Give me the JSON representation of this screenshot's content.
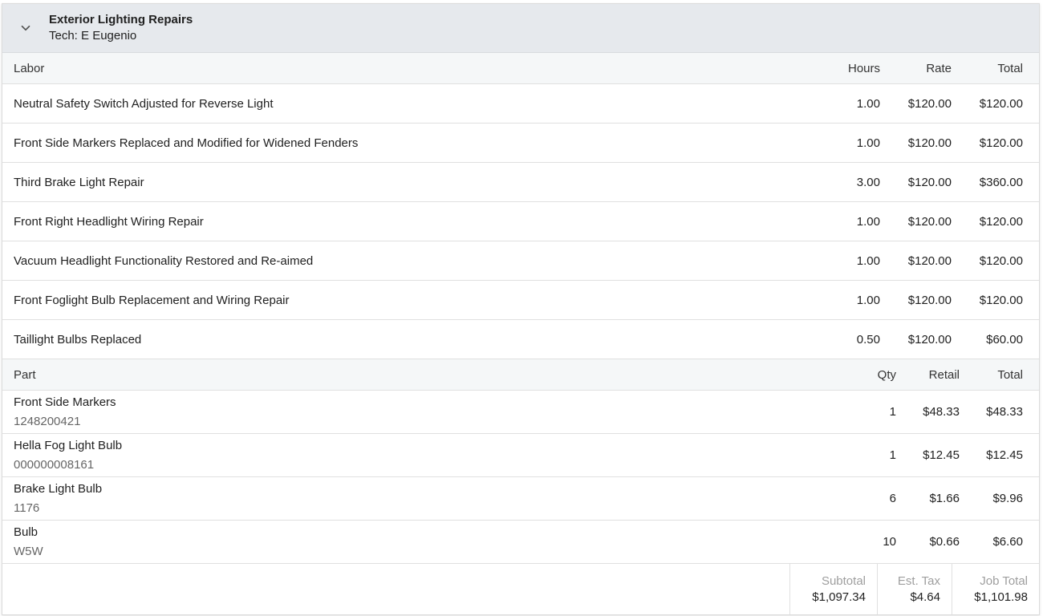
{
  "job": {
    "title": "Exterior Lighting Repairs",
    "tech": "Tech: E Eugenio"
  },
  "labor": {
    "headers": {
      "description": "Labor",
      "hours": "Hours",
      "rate": "Rate",
      "total": "Total"
    },
    "rows": [
      {
        "description": "Neutral Safety Switch Adjusted for Reverse Light",
        "hours": "1.00",
        "rate": "$120.00",
        "total": "$120.00"
      },
      {
        "description": "Front Side Markers Replaced and Modified for Widened Fenders",
        "hours": "1.00",
        "rate": "$120.00",
        "total": "$120.00"
      },
      {
        "description": "Third Brake Light Repair",
        "hours": "3.00",
        "rate": "$120.00",
        "total": "$360.00"
      },
      {
        "description": "Front Right Headlight Wiring Repair",
        "hours": "1.00",
        "rate": "$120.00",
        "total": "$120.00"
      },
      {
        "description": "Vacuum Headlight Functionality Restored and Re-aimed",
        "hours": "1.00",
        "rate": "$120.00",
        "total": "$120.00"
      },
      {
        "description": "Front Foglight Bulb Replacement and Wiring Repair",
        "hours": "1.00",
        "rate": "$120.00",
        "total": "$120.00"
      },
      {
        "description": "Taillight Bulbs Replaced",
        "hours": "0.50",
        "rate": "$120.00",
        "total": "$60.00"
      }
    ]
  },
  "parts": {
    "headers": {
      "description": "Part",
      "qty": "Qty",
      "retail": "Retail",
      "total": "Total"
    },
    "rows": [
      {
        "name": "Front Side Markers",
        "number": "1248200421",
        "qty": "1",
        "retail": "$48.33",
        "total": "$48.33"
      },
      {
        "name": "Hella Fog Light Bulb",
        "number": "000000008161",
        "qty": "1",
        "retail": "$12.45",
        "total": "$12.45"
      },
      {
        "name": "Brake Light Bulb",
        "number": "1176",
        "qty": "6",
        "retail": "$1.66",
        "total": "$9.96"
      },
      {
        "name": "Bulb",
        "number": "W5W",
        "qty": "10",
        "retail": "$0.66",
        "total": "$6.60"
      }
    ]
  },
  "totals": {
    "subtotal_label": "Subtotal",
    "subtotal": "$1,097.34",
    "tax_label": "Est. Tax",
    "tax": "$4.64",
    "job_total_label": "Job Total",
    "job_total": "$1,101.98"
  },
  "icons": {
    "collapse": "chevron-down-icon"
  }
}
